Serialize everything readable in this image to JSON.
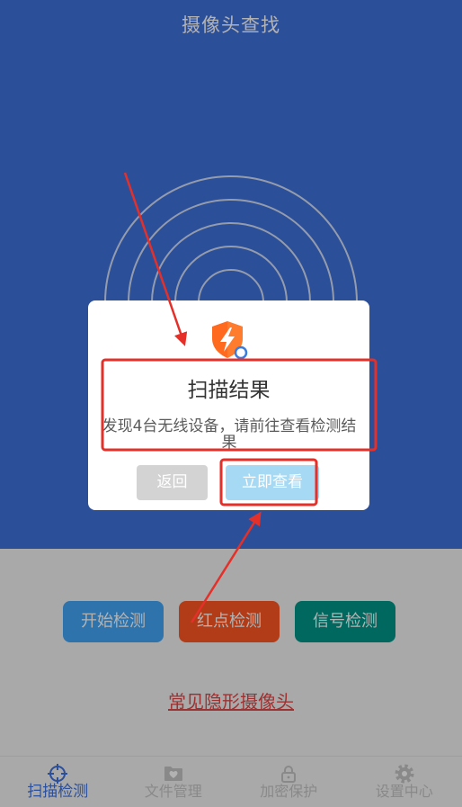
{
  "header": {
    "title": "摄像头查找"
  },
  "actions": {
    "start_label": "开始检测",
    "red_dot_label": "红点检测",
    "signal_label": "信号检测"
  },
  "link": {
    "label": "常见隐形摄像头"
  },
  "nav": {
    "items": [
      {
        "label": "扫描检测",
        "icon": "crosshair-icon",
        "active": true
      },
      {
        "label": "文件管理",
        "icon": "folder-heart-icon",
        "active": false
      },
      {
        "label": "加密保护",
        "icon": "lock-icon",
        "active": false
      },
      {
        "label": "设置中心",
        "icon": "gear-icon",
        "active": false
      }
    ]
  },
  "dialog": {
    "icon": "shield-lightning-icon",
    "title": "扫描结果",
    "message": "发现4台无线设备，请前往查看检测结果",
    "back_label": "返回",
    "confirm_label": "立即查看"
  },
  "colors": {
    "brand": "#3f71dc",
    "page_bg": "#f2f2f2",
    "start_btn": "#42a5f5",
    "red_btn": "#ff5722",
    "signal_btn": "#009688",
    "link": "#e04848",
    "nav_inactive": "#c4c4c4",
    "dlg_back": "#d3d3d3",
    "dlg_confirm": "#a6d9f3",
    "shield": "#ff6a1f",
    "annotation": "#e5302a"
  }
}
